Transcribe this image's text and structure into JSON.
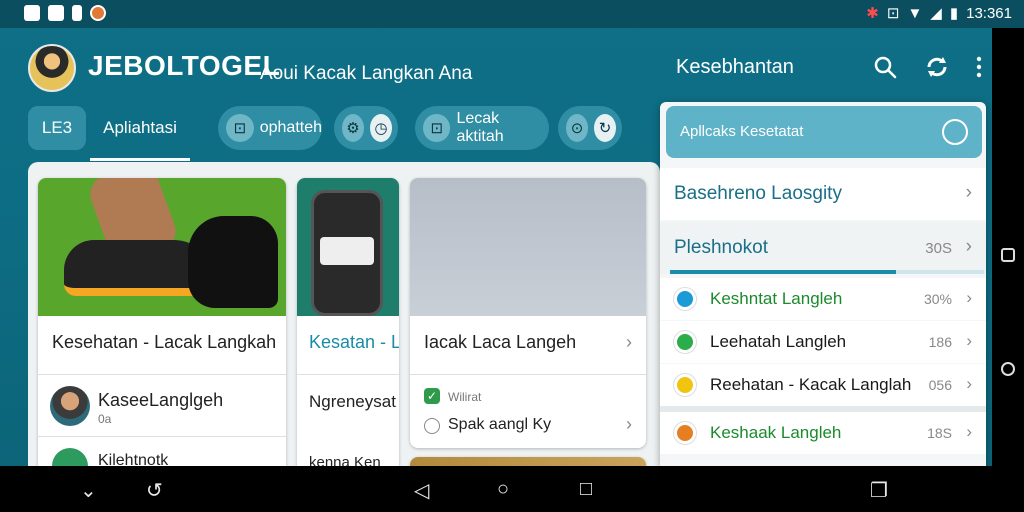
{
  "status_bar": {
    "time": "13:361",
    "left_icons": [
      "lock-icon",
      "keyboard-icon",
      "phone-icon",
      "app-icon"
    ],
    "right_icons": [
      "bug-icon",
      "nfc-icon",
      "wifi-icon",
      "signal-icon",
      "battery-icon"
    ]
  },
  "header": {
    "brand": "JEBOLTOGEL",
    "tagline": "Aoui Kacak Langkan Ana",
    "section_title": "Kesebhantan"
  },
  "tabs": {
    "first": "LE3",
    "active": "Apliahtasi",
    "pills": [
      {
        "label": "ophatteh",
        "icon": "⊡"
      },
      {
        "label": "",
        "icon": "⚙"
      },
      {
        "label": "Lecak aktitah",
        "icon": "⊡"
      },
      {
        "label": "",
        "icon": "⊙"
      }
    ]
  },
  "cards": {
    "card1": {
      "title": "Kesehatan - Lacak Langkah",
      "user_name": "KaseeLanglgeh",
      "user_sub": "0a",
      "bottom_label": "Kilehtnotk"
    },
    "card2": {
      "title": "Kesatan - L",
      "sub": "Ngreneysat",
      "bottom": "kenna Ken"
    },
    "card3": {
      "title": "Iacak Laca Langeh",
      "badge": "Wilirat",
      "sub": "Spak aangl Ky"
    }
  },
  "panel": {
    "header_label": "Apllcaks Kesetatat",
    "items": [
      {
        "label": "Basehreno Laosgity",
        "value": ""
      },
      {
        "label": "Pleshnokot",
        "value": "30S"
      }
    ],
    "progress": 0.72,
    "rows": [
      {
        "label": "Keshntat Langleh",
        "value": "30%",
        "color": "#1a9ad6",
        "text_color": "#1b8a2d"
      },
      {
        "label": "Leehatah Langleh",
        "value": "186",
        "color": "#2cad4b",
        "text_color": "#1a1a1a"
      },
      {
        "label": "Reehatan - Kacak Langlah",
        "value": "056",
        "color": "#f1c40f",
        "text_color": "#1a1a1a"
      },
      {
        "label": "Keshaak Langleh",
        "value": "18S",
        "color": "#e67e22",
        "text_color": "#1b8a2d"
      }
    ]
  },
  "nav": {
    "left": [
      "chevron-down-icon",
      "back-icon"
    ],
    "center": [
      "back-triangle-icon",
      "home-icon",
      "recents-icon"
    ],
    "right": [
      "overview-icon"
    ]
  },
  "colors": {
    "primary": "#0f6f86",
    "panel_header": "#5fb3c8",
    "accent_green": "#2e9b5e"
  }
}
